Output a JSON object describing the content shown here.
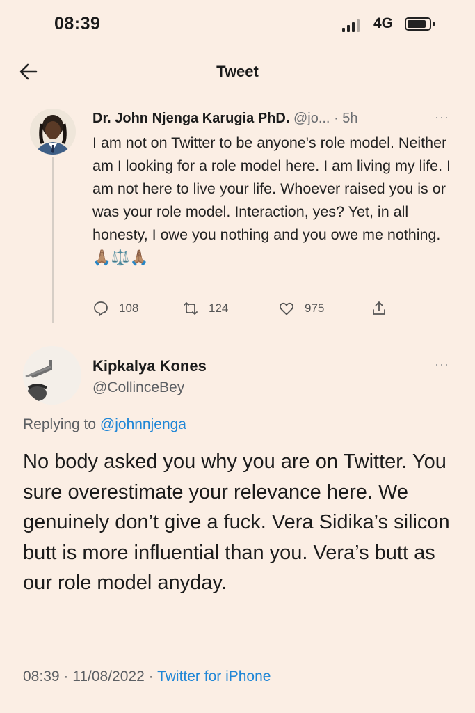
{
  "status_bar": {
    "time": "08:39",
    "network": "4G"
  },
  "header": {
    "title": "Tweet"
  },
  "original_tweet": {
    "author_name": "Dr. John Njenga Karugia PhD.",
    "author_handle": "@jo...",
    "separator": "·",
    "time_ago": "5h",
    "more": "···",
    "text": "I am not on Twitter to be anyone's role model. Neither am I looking for a role model here. I am living my life. I am not here to live your life. Whoever raised you is or was your role model. Interaction, yes? Yet, in all honesty, I owe you nothing and you owe me nothing. 🙏🏽⚖️🙏🏽",
    "actions": {
      "replies": "108",
      "retweets": "124",
      "likes": "975"
    }
  },
  "reply_tweet": {
    "author_name": "Kipkalya Kones",
    "author_handle": "@CollinceBey",
    "more": "···",
    "replying_to_label": "Replying to",
    "replying_to_handle": "@johnnjenga",
    "text": "No body asked you why you are on Twitter. You sure overestimate your relevance here. We genuinely don’t give a fuck. Vera Sidika’s silicon butt is more influential than you. Vera’s butt as our role model anyday.",
    "timestamp": "08:39 · 11/08/2022 ·",
    "client": "Twitter for iPhone"
  },
  "colors": {
    "background": "#fbeee4",
    "link": "#1f86d6",
    "muted": "#5c5f63"
  },
  "icons": [
    "signal-icon",
    "battery-icon",
    "back-arrow-icon",
    "reply-icon",
    "retweet-icon",
    "like-icon",
    "share-icon",
    "more-icon"
  ]
}
